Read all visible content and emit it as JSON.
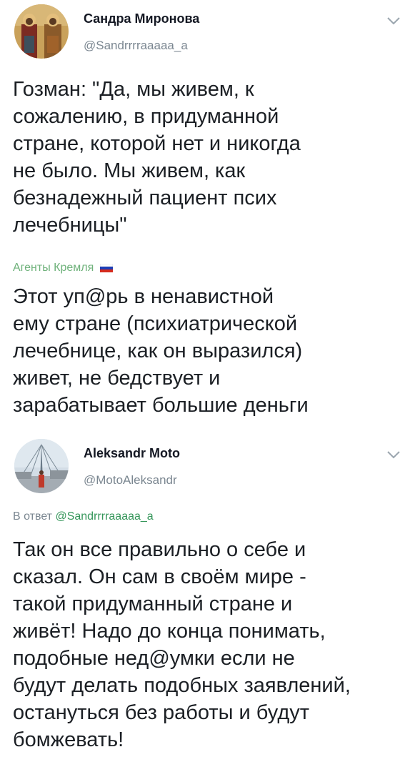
{
  "tweet1": {
    "author_name": "Сандра Миронова",
    "author_handle": "@Sandrrrraaaaa_a",
    "text": "Гозман: \"Да, мы живем, к\nсожалению, в придуманной\nстране, которой нет и никогда\nне было. Мы живем, как\nбезнадежный пациент псих\nлечебницы\"",
    "source_label": "Агенты Кремля",
    "reply_text": "Этот уп@рь в ненавистной\nему стране (психиатрической\nлечебнице, как он выразился)\nживет, не бедствует и\nзарабатывает большие деньги"
  },
  "tweet2": {
    "author_name": "Aleksandr Moto",
    "author_handle": "@MotoAleksandr",
    "reply_prefix": "В ответ",
    "reply_to": "@Sandrrrraaaaa_a",
    "text": "Так он все правильно о себе и\nсказал. Он сам в своём мире -\nтакой придуманный стране и\nживёт! Надо до конца понимать,\nподобные нед@умки если не\nбудут делать подобных заявлений,\nостануться без работы и будут\nбомжевать!"
  },
  "icons": {
    "more_menu": "chevron-down-icon",
    "flag": "russia-flag-icon"
  },
  "colors": {
    "handle": "#7b8791",
    "source_label": "#6fb27b"
  }
}
